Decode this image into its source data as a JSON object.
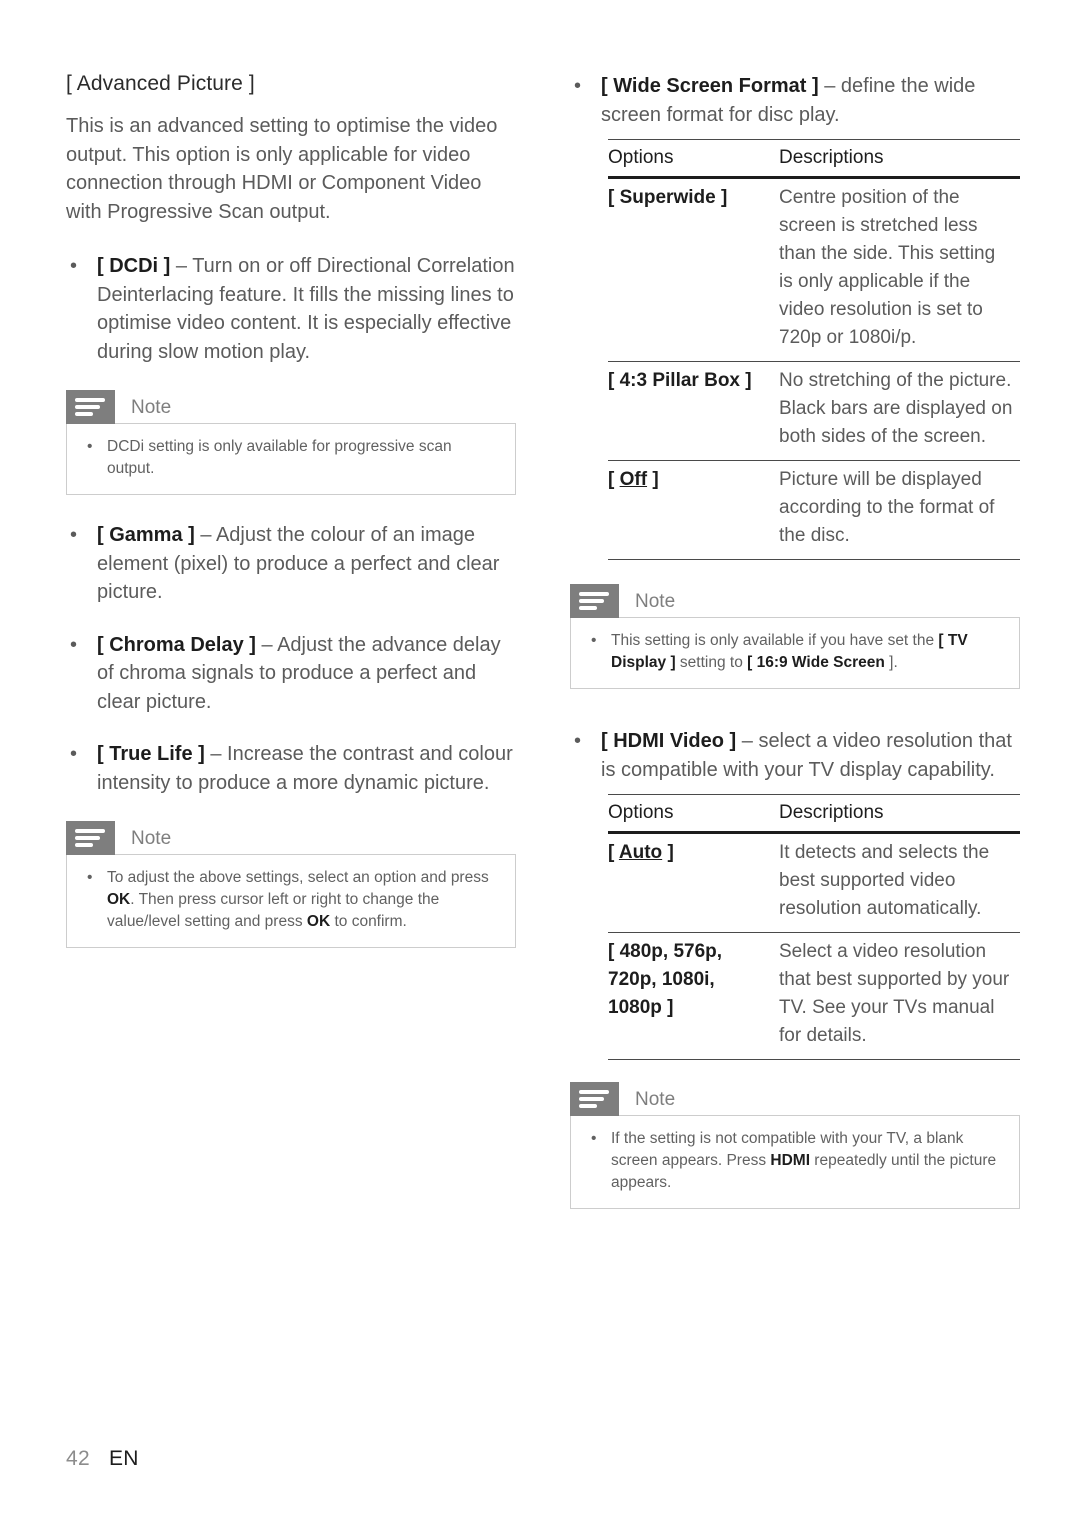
{
  "page": {
    "number": "42",
    "language": "EN"
  },
  "left_column": {
    "heading": "[ Advanced Picture ]",
    "intro": "This is an advanced setting to optimise the video output. This option is only applicable for video connection through HDMI or Component Video with Progressive Scan output.",
    "bullets": [
      {
        "term": "[ DCDi ]",
        "dash": " – ",
        "text": "Turn on or off Directional Correlation Deinterlacing feature.  It fills the missing lines to optimise video content.  It is especially effective during slow motion play."
      },
      {
        "term": "[ Gamma ]",
        "dash": " – ",
        "text": "Adjust the colour of an image element (pixel) to produce a perfect and clear picture."
      },
      {
        "term": "[ Chroma Delay ]",
        "dash": " – ",
        "text": "Adjust the advance delay of chroma signals to produce a perfect and clear picture."
      },
      {
        "term": "[ True Life ]",
        "dash": " – ",
        "text": "Increase the contrast and colour intensity to produce a more dynamic picture."
      }
    ],
    "note_dcdi": {
      "label": "Note",
      "text": "DCDi setting is only available for progressive scan output."
    },
    "note_adjust": {
      "label": "Note",
      "part1": "To adjust the above settings, select an option and press ",
      "kbd1": "OK",
      "part2": ".  Then press cursor left or right to change the value/level setting and press ",
      "kbd2": "OK",
      "part3": " to confirm."
    }
  },
  "right_column": {
    "wide_screen": {
      "term": "[ Wide Screen Format ]",
      "dash": " – ",
      "text": "define the wide screen format for disc play.",
      "table": {
        "headers": [
          "Options",
          "Descriptions"
        ],
        "rows": [
          {
            "option": "[ Superwide ]",
            "option_underline": "",
            "description": "Centre position of the screen is stretched less than the side.  This setting is only applicable if the video resolution is set to 720p or 1080i/p."
          },
          {
            "option": "[ 4:3 Pillar Box ]",
            "option_underline": "",
            "description": "No stretching of the picture.  Black bars are displayed on both sides of the screen."
          },
          {
            "option_prefix": "[ ",
            "option_underline": "Off",
            "option_suffix": " ]",
            "description": "Picture will be displayed according to the format of the disc."
          }
        ]
      },
      "note": {
        "label": "Note",
        "part1": "This setting is only available if you have set the ",
        "kbd1": "[ TV Display ]",
        "part2": " setting to ",
        "kbd2": "[ 16:9 Wide Screen",
        "part3": " ]."
      }
    },
    "hdmi_video": {
      "term": "[ HDMI Video ]",
      "dash": " – ",
      "text": "select a video resolution that is compatible with your TV display capability.",
      "table": {
        "headers": [
          "Options",
          "Descriptions"
        ],
        "rows": [
          {
            "option_prefix": "[ ",
            "option_underline": "Auto",
            "option_suffix": " ]",
            "description": "It detects and selects the best supported video resolution automatically."
          },
          {
            "option": "[ 480p, 576p, 720p, 1080i, 1080p ]",
            "option_underline": "",
            "description": "Select a video resolution that best supported by your TV.  See your TVs manual for details."
          }
        ]
      },
      "note": {
        "label": "Note",
        "part1": "If the setting is not compatible with your TV, a blank screen appears. Press ",
        "kbd1": "HDMI",
        "part2": " repeatedly until the picture appears."
      }
    }
  },
  "colors": {
    "note_icon_bg": "#7e7e7e",
    "note_border": "#cdcdcd",
    "body_text": "#5b5b5b",
    "emphasis_text": "#1d1d1d",
    "table_rule": "#4a4a4a"
  }
}
